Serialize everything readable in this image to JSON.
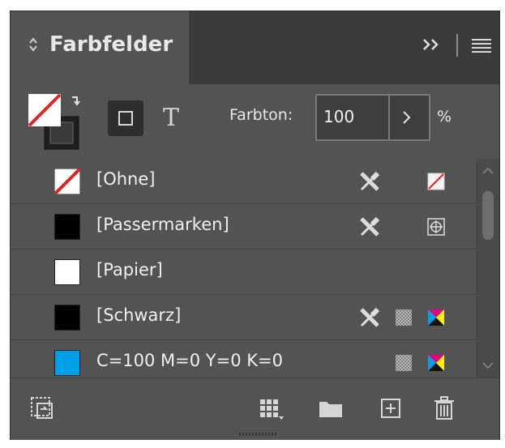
{
  "panel": {
    "tab_title": "Farbfelder",
    "tint_label": "Farbton:",
    "tint_value": "100",
    "tint_unit": "%"
  },
  "swatches": [
    {
      "name": "[Ohne]",
      "color": "none",
      "icons": [
        "no-edit-icon",
        "none-type-icon"
      ]
    },
    {
      "name": "[Passermarken]",
      "color": "#000000",
      "icons": [
        "no-edit-icon",
        "registration-type-icon"
      ]
    },
    {
      "name": "[Papier]",
      "color": "#ffffff",
      "icons": []
    },
    {
      "name": "[Schwarz]",
      "color": "#000000",
      "icons": [
        "no-edit-icon",
        "process-color-icon",
        "cmyk-mode-icon"
      ]
    },
    {
      "name": "C=100 M=0 Y=0 K=0",
      "color": "#00a0e9",
      "icons": [
        "process-color-icon",
        "cmyk-mode-icon"
      ]
    }
  ],
  "colors": {
    "panel_bg": "#535353",
    "tabbar_bg": "#3b3b3b",
    "text": "#f0f0f0",
    "none_red": "#e32222"
  }
}
